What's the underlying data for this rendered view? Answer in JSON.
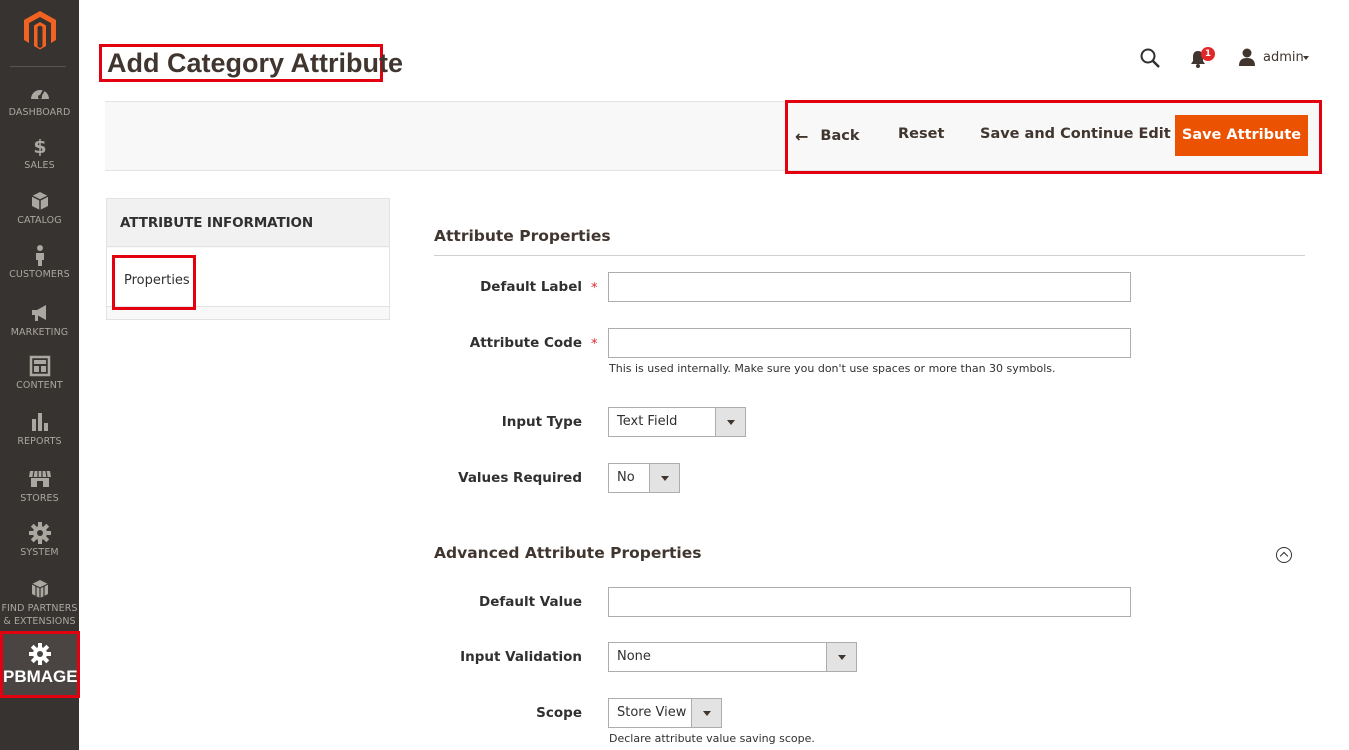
{
  "sidebar": {
    "logo": "magento-logo",
    "items": [
      {
        "label": "DASHBOARD",
        "icon": "dashboard-icon"
      },
      {
        "label": "SALES",
        "icon": "dollar-icon"
      },
      {
        "label": "CATALOG",
        "icon": "box-icon"
      },
      {
        "label": "CUSTOMERS",
        "icon": "person-icon"
      },
      {
        "label": "MARKETING",
        "icon": "megaphone-icon"
      },
      {
        "label": "CONTENT",
        "icon": "layout-icon"
      },
      {
        "label": "REPORTS",
        "icon": "bar-chart-icon"
      },
      {
        "label": "STORES",
        "icon": "store-icon"
      },
      {
        "label": "SYSTEM",
        "icon": "gear-icon"
      },
      {
        "label_line1": "FIND PARTNERS",
        "label_line2": "& EXTENSIONS",
        "icon": "cubes-icon"
      }
    ],
    "pbmage": {
      "label": "PBMAGE",
      "icon": "gear-icon"
    }
  },
  "header": {
    "title": "Add Category Attribute",
    "notification_count": "1",
    "user": "admin"
  },
  "actions": {
    "back": "Back",
    "reset": "Reset",
    "save_continue": "Save and Continue Edit",
    "save": "Save Attribute"
  },
  "tabs": {
    "heading": "ATTRIBUTE INFORMATION",
    "items": [
      {
        "label": "Properties"
      }
    ]
  },
  "form": {
    "section1_title": "Attribute Properties",
    "default_label": {
      "label": "Default Label",
      "value": ""
    },
    "attribute_code": {
      "label": "Attribute Code",
      "value": "",
      "note": "This is used internally. Make sure you don't use spaces or more than 30 symbols."
    },
    "input_type": {
      "label": "Input Type",
      "value": "Text Field"
    },
    "values_required": {
      "label": "Values Required",
      "value": "No"
    },
    "section2_title": "Advanced Attribute Properties",
    "default_value": {
      "label": "Default Value",
      "value": ""
    },
    "input_validation": {
      "label": "Input Validation",
      "value": "None"
    },
    "scope": {
      "label": "Scope",
      "value": "Store View",
      "note": "Declare attribute value saving scope."
    }
  },
  "colors": {
    "sidebar_bg": "#373330",
    "accent": "#eb5202",
    "highlight_border": "#e3000f",
    "required": "#e22626"
  }
}
